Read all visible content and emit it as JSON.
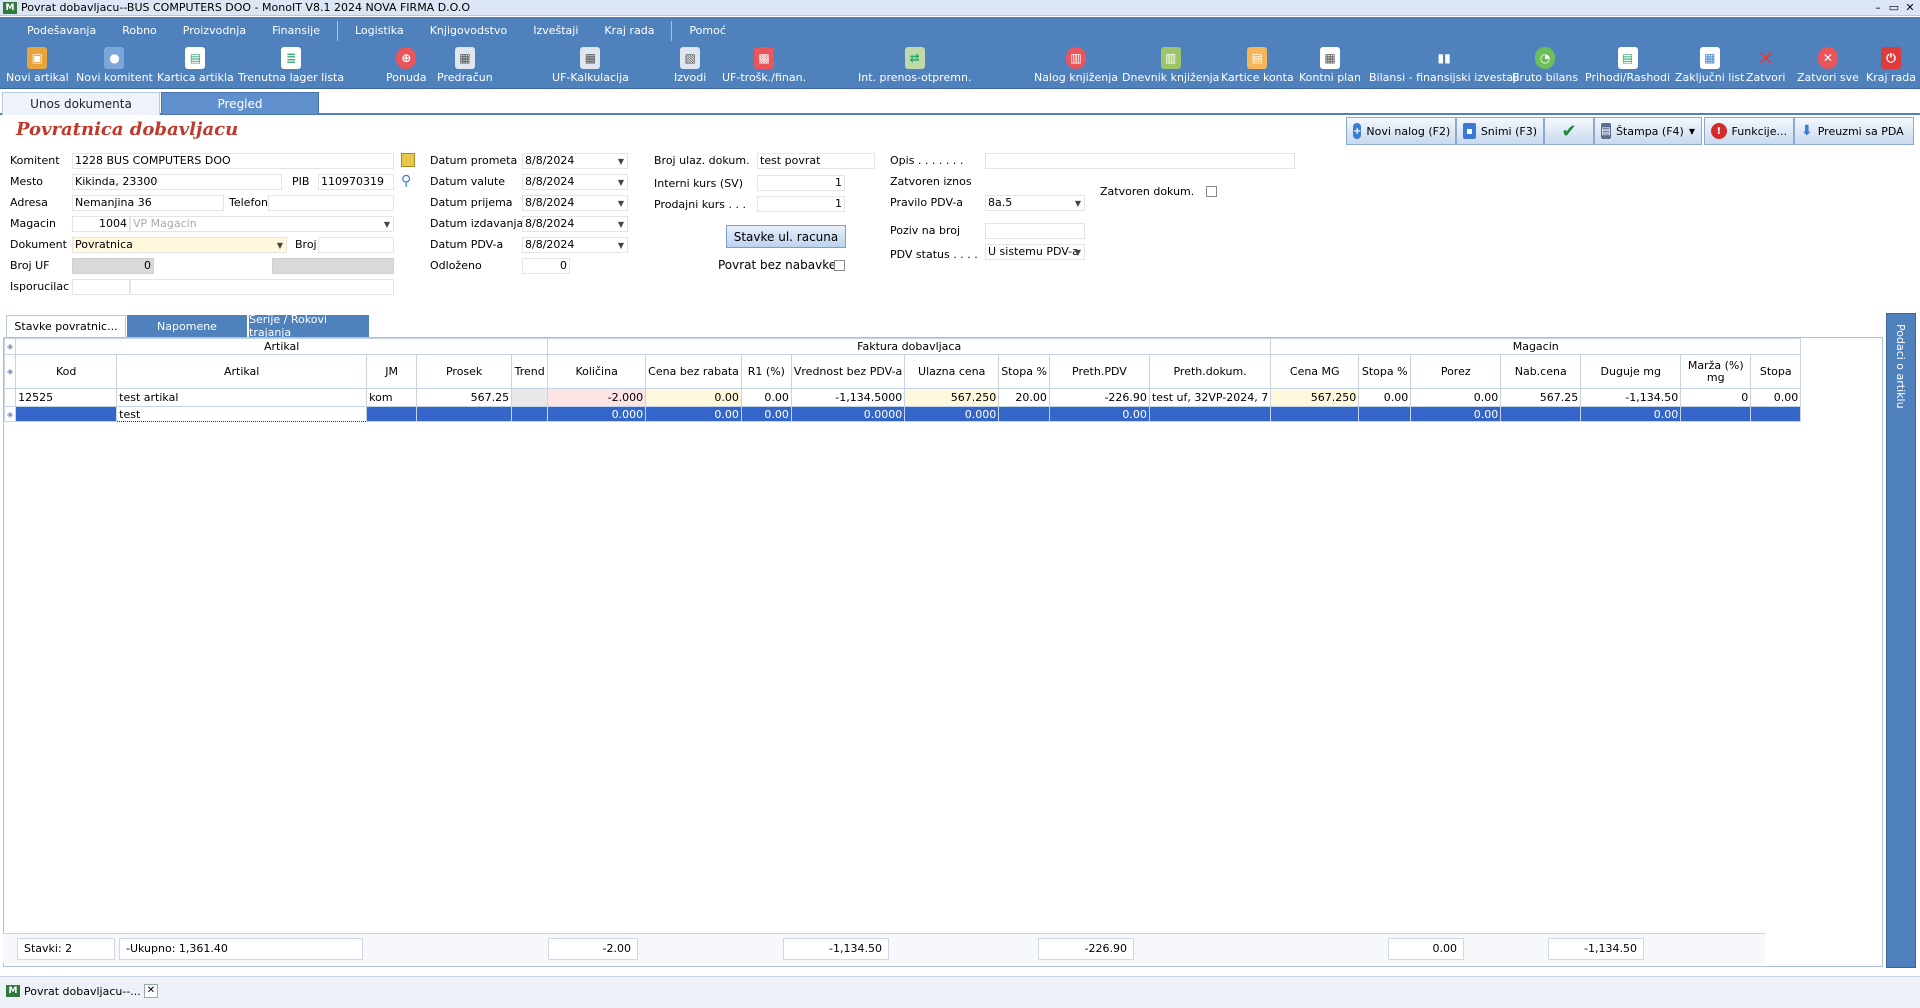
{
  "window": {
    "title": "Povrat dobavljacu--BUS COMPUTERS DOO - MonoIT V8.1 2024 NOVA FIRMA D.O.O",
    "controls": [
      "–",
      "▭",
      "✕"
    ]
  },
  "menu": [
    "Podešavanja",
    "Robno",
    "Proizvodnja",
    "Finansije",
    "Logistika",
    "Knjigovodstvo",
    "Izveštaji",
    "Kraj rada",
    "Pomoć"
  ],
  "toolbar": [
    {
      "label": "Novi artikal",
      "icon": "box-icon",
      "color": "#e8a43a"
    },
    {
      "label": "Novi komitent",
      "icon": "person-icon",
      "color": "#7aa7d8"
    },
    {
      "label": "Kartica artikla",
      "icon": "card-icon",
      "color": "#ffffff"
    },
    {
      "label": "Trenutna lager lista",
      "icon": "list-icon",
      "color": "#ffffff"
    },
    {
      "label": "Ponuda",
      "icon": "offer-icon",
      "color": "#e8555a"
    },
    {
      "label": "Predračun",
      "icon": "invoice-icon",
      "color": "#dfe6ef"
    },
    {
      "label": "UF-Kalkulacija",
      "icon": "calc-icon",
      "color": "#dfe6ef"
    },
    {
      "label": "Izvodi",
      "icon": "statement-icon",
      "color": "#dfe6ef"
    },
    {
      "label": "UF-trošk./finan.",
      "icon": "cost-icon",
      "color": "#e8555a"
    },
    {
      "label": "Int. prenos-otpremn.",
      "icon": "transfer-icon",
      "color": "#bfd9a8"
    },
    {
      "label": "Nalog knjiženja",
      "icon": "book-icon",
      "color": "#e8555a"
    },
    {
      "label": "Dnevnik knjiženja",
      "icon": "journal-icon",
      "color": "#9cc46a"
    },
    {
      "label": "Kartice konta",
      "icon": "account-card-icon",
      "color": "#f5b55a"
    },
    {
      "label": "Kontni plan",
      "icon": "plan-icon",
      "color": "#ffffff"
    },
    {
      "label": "Bilansi - finansijski izvestaji",
      "icon": "bars-icon",
      "color": "#ffffff"
    },
    {
      "label": "Bruto bilans",
      "icon": "pie-icon",
      "color": "#6bbf5a"
    },
    {
      "label": "Prihodi/Rashodi",
      "icon": "income-icon",
      "color": "#ffffff"
    },
    {
      "label": "Zaključni list",
      "icon": "sheet-icon",
      "color": "#ffffff"
    },
    {
      "label": "Zatvori",
      "icon": "close-icon",
      "color": "#e03b3b"
    },
    {
      "label": "Zatvori sve",
      "icon": "close-all-icon",
      "color": "#e8555a"
    },
    {
      "label": "Kraj rada",
      "icon": "power-icon",
      "color": "#e03b3b"
    }
  ],
  "view_tabs": {
    "entry": "Unos dokumenta",
    "review": "Pregled"
  },
  "form_title": "Povratnica dobavljacu",
  "actions": {
    "new_order": "Novi nalog (F2)",
    "save": "Snimi (F3)",
    "confirm": "✔",
    "print": "Štampa (F4)",
    "functions": "Funkcije...",
    "pda": "Preuzmi sa PDA"
  },
  "fields": {
    "komitent_label": "Komitent",
    "komitent_value": "1228 BUS COMPUTERS DOO",
    "mesto_label": "Mesto",
    "mesto_value": "Kikinda, 23300",
    "pib_label": "PIB",
    "pib_value": "110970319",
    "adresa_label": "Adresa",
    "adresa_value": "Nemanjina 36",
    "telefon_label": "Telefon",
    "telefon_value": "",
    "magacin_label": "Magacin",
    "magacin_code": "1004",
    "magacin_name": "VP Magacin",
    "dokument_label": "Dokument",
    "dokument_value": "Povratnica",
    "broj_label": "Broj",
    "broj_value": "",
    "broj_uf_label": "Broj UF",
    "broj_uf_value": "0",
    "isporucilac_label": "Isporucilac",
    "isporucilac_value": "",
    "datum_prometa_label": "Datum prometa",
    "datum_prometa": "8/8/2024",
    "datum_valute_label": "Datum valute",
    "datum_valute": "8/8/2024",
    "datum_prijema_label": "Datum prijema",
    "datum_prijema": "8/8/2024",
    "datum_izdavanja_label": "Datum izdavanja",
    "datum_izdavanja": "8/8/2024",
    "datum_pdva_label": "Datum PDV-a",
    "datum_pdva": "8/8/2024",
    "odlozeno_label": "Odloženo",
    "odlozeno": "0",
    "broj_ulaz_label": "Broj ulaz. dokum.",
    "broj_ulaz": "test povrat",
    "interni_kurs_label": "Interni kurs (SV)",
    "interni_kurs": "1",
    "prodajni_kurs_label": "Prodajni kurs . . .",
    "prodajni_kurs": "1",
    "stavke_btn": "Stavke ul. racuna",
    "povrat_bez_label": "Povrat bez nabavke",
    "opis_label": "Opis . . . . . . .",
    "opis": "",
    "zatvoren_iznos_label": "Zatvoren iznos",
    "pravilo_label": "Pravilo PDV-a",
    "pravilo": "8a.5",
    "zatvoren_dokum_label": "Zatvoren dokum.",
    "poziv_label": "Poziv na broj",
    "poziv": "",
    "pdv_status_label": "PDV status . . . .",
    "pdv_status": "U sistemu PDV-a"
  },
  "sub_tabs": [
    "Stavke povratnic...",
    "Napomene",
    "Serije / Rokovi trajanja"
  ],
  "grid": {
    "groups": [
      "Artikal",
      "Faktura dobavljaca",
      "Magacin"
    ],
    "columns": [
      "Kod",
      "Artikal",
      "JM",
      "Prosek",
      "Trend",
      "Količina",
      "Cena bez rabata",
      "R1 (%)",
      "Vrednost bez PDV-a",
      "Ulazna cena",
      "Stopa %",
      "Preth.PDV",
      "Preth.dokum.",
      "Cena MG",
      "Stopa %",
      "Porez",
      "Nab.cena",
      "Duguje mg",
      "Marža (%) mg",
      "Stopa"
    ],
    "rows": [
      [
        "12525",
        "test artikal",
        "kom",
        "567.25",
        "",
        "-2.000",
        "0.00",
        "0.00",
        "-1,134.5000",
        "567.250",
        "20.00",
        "-226.90",
        "test uf, 32VP-2024, 7",
        "567.250",
        "0.00",
        "0.00",
        "567.25",
        "-1,134.50",
        "0",
        "0.00"
      ],
      [
        "",
        "test",
        "",
        "",
        "",
        "0.000",
        "0.00",
        "0.00",
        "0.0000",
        "0.000",
        "",
        "0.00",
        "",
        "",
        "",
        "0.00",
        "",
        "0.00",
        "",
        ""
      ]
    ]
  },
  "footer": {
    "stavki": "Stavki: 2",
    "ukupno": "-Ukupno:  1,361.40",
    "kolicina": "-2.00",
    "vrednost": "-1,134.50",
    "preth_pdv": "-226.90",
    "porez": "0.00",
    "duguje": "-1,134.50"
  },
  "side_panel": "Podaci o artiklu",
  "status_tab": "Povrat dobavljacu--..."
}
